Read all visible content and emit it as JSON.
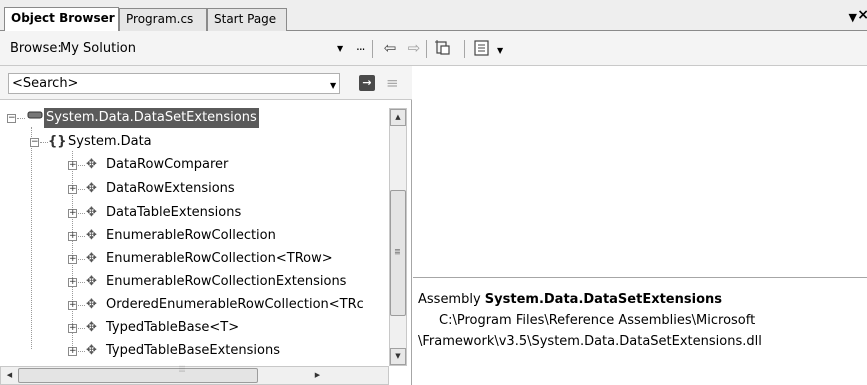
{
  "tabs": [
    {
      "label": "Object Browser",
      "active": true
    },
    {
      "label": "Program.cs",
      "active": false
    },
    {
      "label": "Start Page",
      "active": false
    }
  ],
  "tab_menu_icon": "chevron-down-icon",
  "tab_close_icon": "close-icon",
  "browse": {
    "label": "Browse:",
    "scope": "My Solution",
    "ellipsis": "...",
    "toolbar_icons": [
      "back-arrow-icon",
      "forward-arrow-icon",
      "add-reference-icon",
      "settings-icon"
    ]
  },
  "search": {
    "value": "<Search>",
    "go_icon": "arrow-right-icon",
    "clear_icon": "clear-search-icon"
  },
  "tree": {
    "root": {
      "label": "System.Data.DataSetExtensions",
      "icon": "assembly-icon",
      "selected": true
    },
    "namespace": {
      "label": "System.Data",
      "icon": "namespace-icon"
    },
    "types": [
      {
        "label": "DataRowComparer",
        "icon": "class-icon"
      },
      {
        "label": "DataRowExtensions",
        "icon": "class-icon"
      },
      {
        "label": "DataTableExtensions",
        "icon": "class-icon"
      },
      {
        "label": "EnumerableRowCollection",
        "icon": "class-icon"
      },
      {
        "label": "EnumerableRowCollection<TRow>",
        "icon": "class-icon"
      },
      {
        "label": "EnumerableRowCollectionExtensions",
        "icon": "class-icon"
      },
      {
        "label": "OrderedEnumerableRowCollection<TRc",
        "icon": "class-icon"
      },
      {
        "label": "TypedTableBase<T>",
        "icon": "class-icon"
      },
      {
        "label": "TypedTableBaseExtensions",
        "icon": "class-icon"
      }
    ]
  },
  "scroll": {
    "vertical_position": 0.45,
    "horizontal_position": 0.0
  },
  "description": {
    "prefix": "Assembly ",
    "name": "System.Data.DataSetExtensions",
    "path_line1": "C:\\Program Files\\Reference Assemblies\\Microsoft",
    "path_line2": "\\Framework\\v3.5\\System.Data.DataSetExtensions.dll"
  },
  "colors": {
    "selection": "#5a5a5a",
    "chrome": "#f4f4f4",
    "border": "#8a8a8a"
  }
}
